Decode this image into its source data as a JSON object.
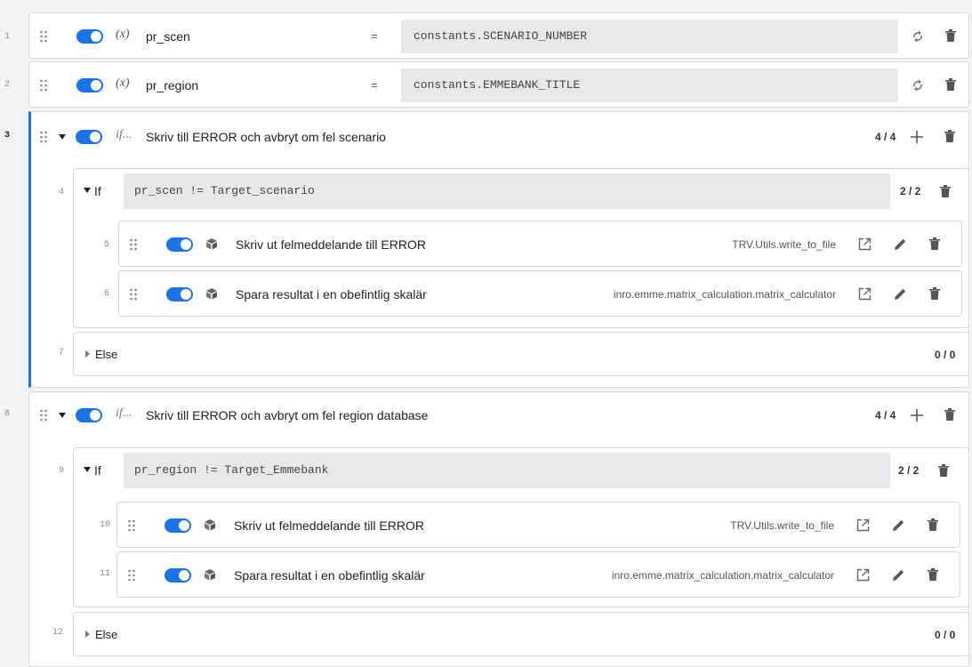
{
  "rows": [
    {
      "line": "1",
      "kind": "variable",
      "symbol": "(x)",
      "name": "pr_scen",
      "operator": "=",
      "expression": "constants.SCENARIO_NUMBER"
    },
    {
      "line": "2",
      "kind": "variable",
      "symbol": "(x)",
      "name": "pr_region",
      "operator": "=",
      "expression": "constants.EMMEBANK_TITLE"
    }
  ],
  "blocks": [
    {
      "line": "3",
      "symbol": "if...",
      "title": "Skriv till ERROR och avbryt om fel scenario",
      "count": "4 / 4",
      "if_branch": {
        "line": "4",
        "label": "If",
        "condition": "pr_scen != Target_scenario",
        "count": "2 / 2",
        "tools": [
          {
            "line": "5",
            "title": "Skriv ut felmeddelande till ERROR",
            "func": "TRV.Utils.write_to_file"
          },
          {
            "line": "6",
            "title": "Spara resultat i en obefintlig skalär",
            "func": "inro.emme.matrix_calculation.matrix_calculator"
          }
        ]
      },
      "else_branch": {
        "line": "7",
        "label": "Else",
        "count": "0 / 0"
      }
    },
    {
      "line": "8",
      "symbol": "if...",
      "title": "Skriv till ERROR och avbryt om fel region database",
      "count": "4 / 4",
      "if_branch": {
        "line": "9",
        "label": "If",
        "condition": "pr_region != Target_Emmebank",
        "count": "2 / 2",
        "tools": [
          {
            "line": "10",
            "title": "Skriv ut felmeddelande till ERROR",
            "func": "TRV.Utils.write_to_file"
          },
          {
            "line": "11",
            "title": "Spara resultat i en obefintlig skalär",
            "func": "inro.emme.matrix_calculation.matrix_calculator"
          }
        ]
      },
      "else_branch": {
        "line": "12",
        "label": "Else",
        "count": "0 / 0"
      }
    }
  ],
  "colors": {
    "accent": "#1a73e8",
    "background": "#f1f3f4",
    "expression_bg": "#e8e8ea"
  },
  "icons": [
    "drag-handle-icon",
    "toggle-switch",
    "swap-icon",
    "trash-icon",
    "plus-icon",
    "open-external-icon",
    "pencil-icon",
    "tool-box-icon",
    "caret-down-icon",
    "caret-right-icon"
  ]
}
